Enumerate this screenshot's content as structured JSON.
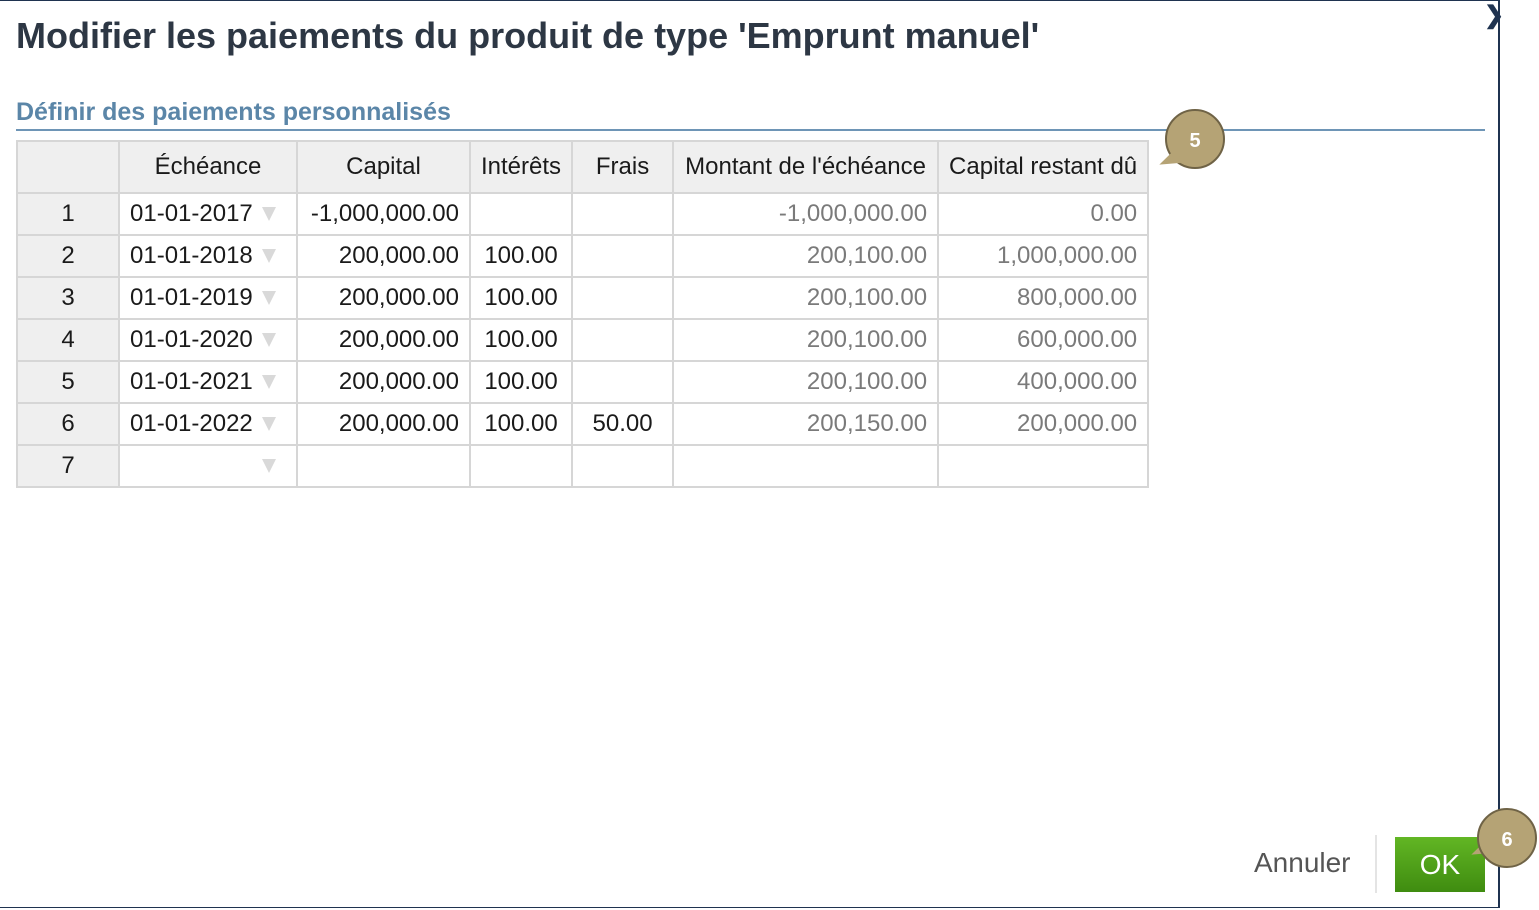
{
  "dialog": {
    "title": "Modifier les paiements du produit de type 'Emprunt manuel'",
    "close_icon": "close-icon"
  },
  "section": {
    "title": "Définir des paiements personnalisés"
  },
  "table": {
    "columns": [
      "",
      "Échéance",
      "Capital",
      "Intérêts",
      "Frais",
      "Montant de l'échéance",
      "Capital restant dû"
    ],
    "rows": [
      {
        "num": "1",
        "date": "01-01-2017",
        "capital": "-1,000,000.00",
        "interets": "",
        "frais": "",
        "montant": "-1,000,000.00",
        "restant": "0.00"
      },
      {
        "num": "2",
        "date": "01-01-2018",
        "capital": "200,000.00",
        "interets": "100.00",
        "frais": "",
        "montant": "200,100.00",
        "restant": "1,000,000.00"
      },
      {
        "num": "3",
        "date": "01-01-2019",
        "capital": "200,000.00",
        "interets": "100.00",
        "frais": "",
        "montant": "200,100.00",
        "restant": "800,000.00"
      },
      {
        "num": "4",
        "date": "01-01-2020",
        "capital": "200,000.00",
        "interets": "100.00",
        "frais": "",
        "montant": "200,100.00",
        "restant": "600,000.00"
      },
      {
        "num": "5",
        "date": "01-01-2021",
        "capital": "200,000.00",
        "interets": "100.00",
        "frais": "",
        "montant": "200,100.00",
        "restant": "400,000.00"
      },
      {
        "num": "6",
        "date": "01-01-2022",
        "capital": "200,000.00",
        "interets": "100.00",
        "frais": "50.00",
        "montant": "200,150.00",
        "restant": "200,000.00"
      },
      {
        "num": "7",
        "date": "",
        "capital": "",
        "interets": "",
        "frais": "",
        "montant": "",
        "restant": ""
      }
    ]
  },
  "callouts": {
    "table": "5",
    "ok": "6"
  },
  "footer": {
    "cancel_label": "Annuler",
    "ok_label": "OK"
  },
  "colors": {
    "title": "#2d3744",
    "section": "#5b86a8",
    "ok_button": "#4fa018",
    "callout": "#b5a375"
  }
}
